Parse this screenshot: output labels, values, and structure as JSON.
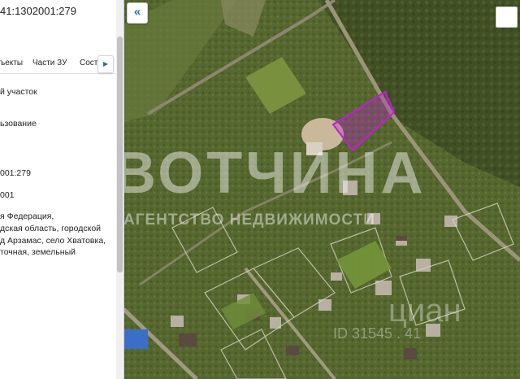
{
  "panel": {
    "title": "41:1302001:279",
    "tabs": [
      "ъекты",
      "Части ЗУ",
      "Соста"
    ],
    "tab_next_icon": "chevron-right-icon",
    "lines": [
      "й участок",
      "ьзование",
      "001:279",
      "001",
      "я Федерация,",
      "дская область, городской",
      "д Арзамас, село Хватовка,",
      "точная, земельный"
    ]
  },
  "map": {
    "collapse_icon": "double-chevron-left-icon",
    "parcel_color": "#c020d0",
    "watermark_main": "ВОТЧИНА",
    "watermark_sub": "АГЕНТСТВО НЕДВИЖИМОСТИ",
    "watermark_cian": "циан",
    "watermark_id": "ID 31545 . 41"
  }
}
